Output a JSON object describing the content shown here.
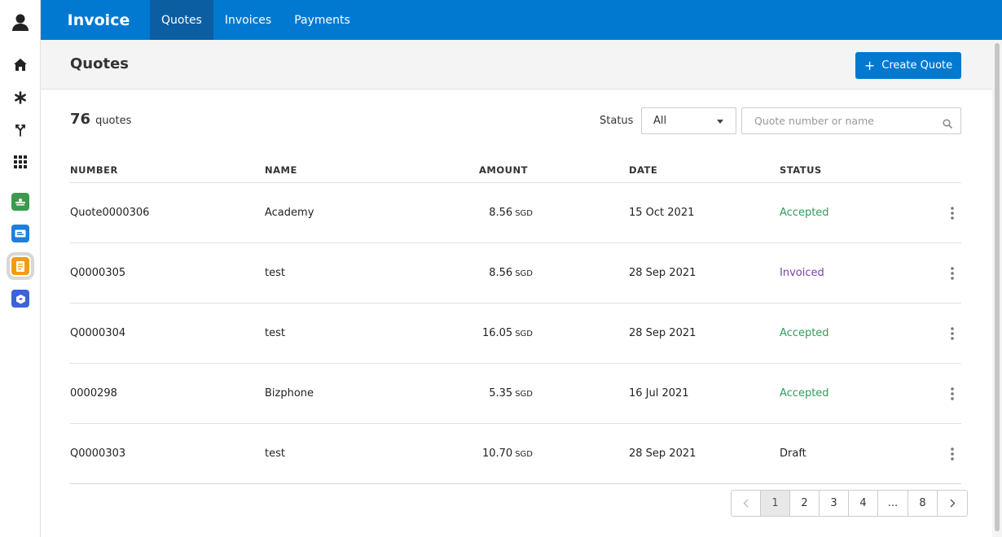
{
  "app": {
    "brand": "Invoice"
  },
  "nav": {
    "tabs": [
      {
        "label": "Quotes",
        "active": true
      },
      {
        "label": "Invoices",
        "active": false
      },
      {
        "label": "Payments",
        "active": false
      }
    ]
  },
  "rail": {
    "items": [
      {
        "icon": "user-avatar-icon"
      },
      {
        "icon": "home-icon"
      },
      {
        "icon": "asterisk-icon"
      },
      {
        "icon": "merge-fork-icon"
      },
      {
        "icon": "apps-grid-icon"
      },
      {
        "icon": "green-app-icon",
        "color": "#3a9b4f"
      },
      {
        "icon": "blue-ticket-app-icon",
        "color": "#1f7fd8"
      },
      {
        "icon": "orange-invoice-app-icon",
        "color": "#f39c12",
        "active": true
      },
      {
        "icon": "blue-box-app-icon",
        "color": "#3b63d8"
      }
    ]
  },
  "page": {
    "title": "Quotes",
    "create_label": "Create Quote",
    "create_icon": "plus-icon"
  },
  "toolbar": {
    "count": "76",
    "count_label": "quotes",
    "status_label": "Status",
    "status_value": "All",
    "search_placeholder": "Quote number or name",
    "search_value": ""
  },
  "table": {
    "headers": {
      "number": "NUMBER",
      "name": "NAME",
      "amount": "AMOUNT",
      "date": "DATE",
      "status": "STATUS"
    },
    "rows": [
      {
        "number": "Quote0000306",
        "name": "Academy",
        "amount": "8.56",
        "currency": "SGD",
        "date": "15 Oct 2021",
        "status": "Accepted",
        "status_type": "accepted"
      },
      {
        "number": "Q0000305",
        "name": "test",
        "amount": "8.56",
        "currency": "SGD",
        "date": "28 Sep 2021",
        "status": "Invoiced",
        "status_type": "invoiced"
      },
      {
        "number": "Q0000304",
        "name": "test",
        "amount": "16.05",
        "currency": "SGD",
        "date": "28 Sep 2021",
        "status": "Accepted",
        "status_type": "accepted"
      },
      {
        "number": "0000298",
        "name": "Bizphone",
        "amount": "5.35",
        "currency": "SGD",
        "date": "16 Jul 2021",
        "status": "Accepted",
        "status_type": "accepted"
      },
      {
        "number": "Q0000303",
        "name": "test",
        "amount": "10.70",
        "currency": "SGD",
        "date": "28 Sep 2021",
        "status": "Draft",
        "status_type": "draft"
      }
    ]
  },
  "pagination": {
    "prev_icon": "chevron-left-icon",
    "next_icon": "chevron-right-icon",
    "pages": [
      "1",
      "2",
      "3",
      "4",
      "...",
      "8"
    ],
    "current": "1"
  },
  "colors": {
    "brand_blue": "#0179d1",
    "active_tab": "#0b5ea1",
    "accepted": "#2e9e5b",
    "invoiced": "#7b3fa6"
  }
}
